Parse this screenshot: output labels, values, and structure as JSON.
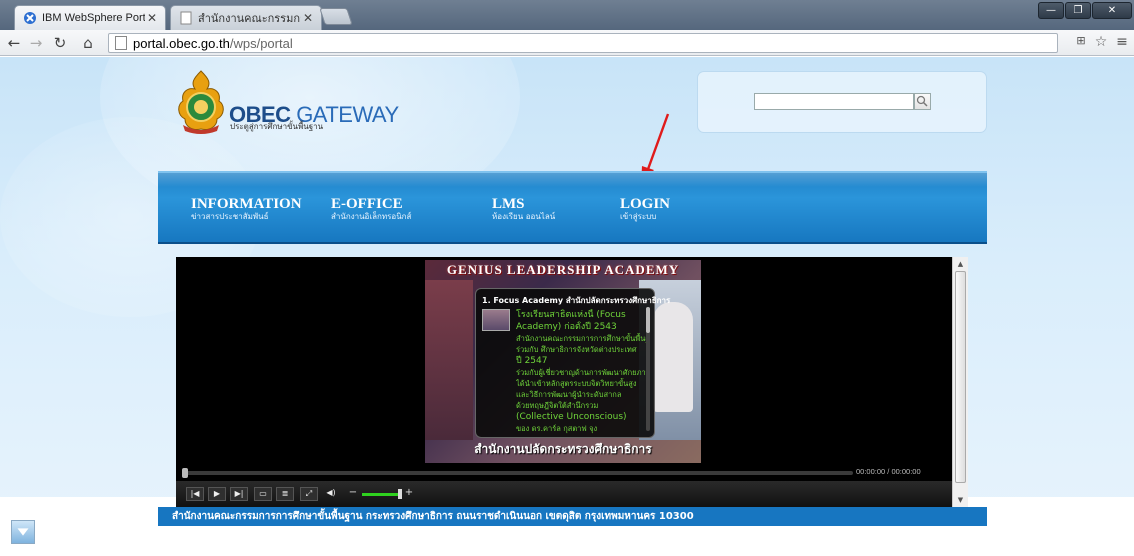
{
  "browser": {
    "tabs": [
      {
        "label": "IBM WebSphere Portal",
        "active": true
      },
      {
        "label": "สำนักงานคณะกรรมการการศึ",
        "active": false
      }
    ],
    "url_host": "portal.obec.go.th",
    "url_path": "/wps/portal"
  },
  "site": {
    "brand_main": "OBEC",
    "brand_accent": "GATEWAY",
    "brand_sub": "ประตูสู่การศึกษาขั้นพื้นฐาน",
    "search_placeholder": ""
  },
  "nav": [
    {
      "title": "INFORMATION",
      "sub": "ข่าวสารประชาสัมพันธ์"
    },
    {
      "title": "E-OFFICE",
      "sub": "สำนักงานอิเล็กทรอนิกส์"
    },
    {
      "title": "LMS",
      "sub": "ห้องเรียน ออนไลน์"
    },
    {
      "title": "LOGIN",
      "sub": "เข้าสู่ระบบ"
    }
  ],
  "video": {
    "banner": "GENIUS LEADERSHIP ACADEMY",
    "popup_title": "1. Focus Academy สำนักปลัดกระทรวงศึกษาธิการ",
    "popup_lines": [
      "โรงเรียนสาธิตแห่งนี้ (Focus",
      "Academy) ก่อตั้งปี 2543",
      "สำนักงานคณะกรรมการการศึกษาขั้นพื้นฐาน",
      "ร่วมกับ ศึกษาธิการจังหวัดต่างประเทศ",
      "ปี 2547",
      "ร่วมกับผู้เชี่ยวชาญด้านการพัฒนาศักยภาพ",
      "ได้นำเข้าหลักสูตรระบบจิตวิทยาขั้นสูง",
      "และวิธีการพัฒนาผู้นำระดับสากล",
      "ด้วยทฤษฎีจิตใต้สำนึกรวม",
      "(Collective Unconscious)",
      "ของ ดร.คาร์ล กุสตาฟ จุง"
    ],
    "caption": "สำนักงานปลัดกระทรวงศึกษาธิการ",
    "timecode": "00:00:00 / 00:00:00",
    "volume_level": 0.8
  },
  "footer": "สำนักงานคณะกรรมการการศึกษาขั้นพื้นฐาน กระทรวงศึกษาธิการ ถนนราชดำเนินนอก เขตดุสิต กรุงเทพมหานคร 10300",
  "colors": {
    "nav_blue": "#1c7fc6",
    "footer_blue": "#1776c1",
    "arrow_red": "#e01b1b",
    "volume_green": "#2fd11f"
  }
}
